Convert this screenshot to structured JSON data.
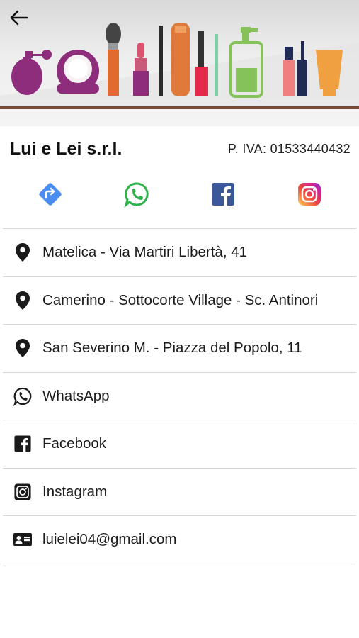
{
  "company": {
    "name": "Lui e Lei s.r.l.",
    "vat": "P. IVA: 01533440432"
  },
  "social_buttons": [
    {
      "name": "directions",
      "color": "#4a8cf0"
    },
    {
      "name": "whatsapp",
      "color": "#2db24a"
    },
    {
      "name": "facebook",
      "color": "#3b5998"
    },
    {
      "name": "instagram",
      "color": "#d6249f"
    }
  ],
  "contacts": [
    {
      "icon": "map-pin-icon",
      "label": "Matelica - Via Martiri Libertà, 41"
    },
    {
      "icon": "map-pin-icon",
      "label": "Camerino - Sottocorte Village - Sc. Antinori"
    },
    {
      "icon": "map-pin-icon",
      "label": "San Severino M. - Piazza del Popolo, 11"
    },
    {
      "icon": "whatsapp-icon",
      "label": "WhatsApp"
    },
    {
      "icon": "facebook-icon",
      "label": "Facebook"
    },
    {
      "icon": "instagram-icon",
      "label": "Instagram"
    },
    {
      "icon": "contact-card-icon",
      "label": "luielei04@gmail.com"
    }
  ],
  "colors": {
    "banner_line": "#7a4a35",
    "divider": "#d6d6d6"
  }
}
